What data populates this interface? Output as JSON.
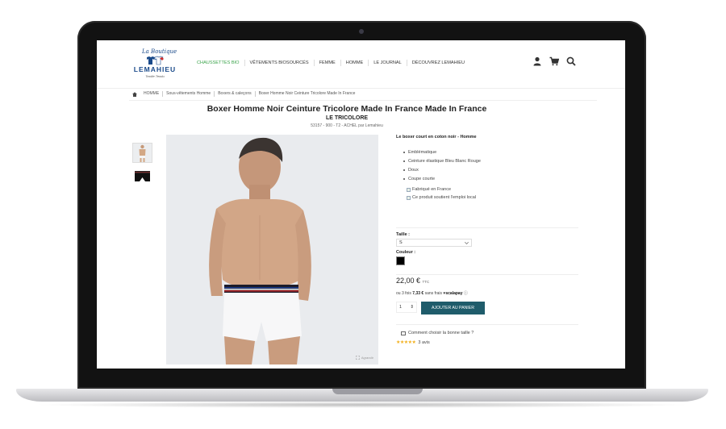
{
  "header": {
    "logo": {
      "top": "La Boutique",
      "name": "LEMAHIEU",
      "tagline": "Textile Tendu"
    },
    "nav": [
      {
        "label": "CHAUSSETTES BIO",
        "active": true
      },
      {
        "label": "VÊTEMENTS BIOSOURCÉS",
        "active": false
      },
      {
        "label": "FEMME",
        "active": false
      },
      {
        "label": "HOMME",
        "active": false
      },
      {
        "label": "LE JOURNAL",
        "active": false
      },
      {
        "label": "DÉCOUVREZ LEMAHIEU",
        "active": false
      }
    ],
    "icons": [
      "user-icon",
      "cart-icon",
      "search-icon"
    ]
  },
  "breadcrumb": [
    "HOMME",
    "Sous-vêtements Homme",
    "Boxers & caleçons",
    "Boxer Homme Noir Ceinture Tricolore Made In France"
  ],
  "product": {
    "title": "Boxer Homme Noir Ceinture Tricolore Made In France Made In France",
    "subtitle": "LE TRICOLORE",
    "meta": "53157 - 900 - T2 - ACHEL par Lemahieu",
    "description_title": "Le boxer court en coton noir - Homme",
    "features": [
      "Emblématique",
      "Ceinture élastique Bleu Blanc Rouge",
      "Doux",
      "Coupe courte"
    ],
    "badges": [
      "Fabriqué en France",
      "Ce produit soutient l'emploi local"
    ],
    "size_label": "Taille :",
    "size_value": "S",
    "color_label": "Couleur :",
    "color_swatch": "#000000",
    "price": "22,00 €",
    "price_suffix": "TTC",
    "scalapay_prefix": "ou 3 fois",
    "scalapay_amount": "7,33 €",
    "scalapay_suffix": "sans frais",
    "scalapay_brand": "scalapay",
    "quantity": "1",
    "add_to_cart": "AJOUTER AU PANIER",
    "size_guide": "Comment choisir la bonne taille ?",
    "rating_stars": 5,
    "rating_text": "3 avis",
    "zoom_label": "Agrandir"
  },
  "colors": {
    "accent": "#1f5c6b",
    "nav_active": "#3aa34a",
    "star": "#f2b01e"
  }
}
